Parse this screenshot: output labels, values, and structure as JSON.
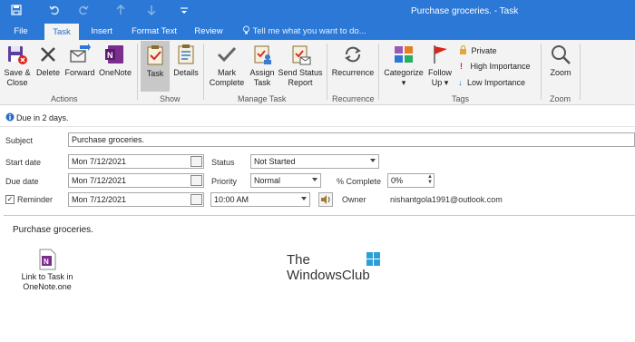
{
  "window": {
    "title": "Purchase groceries. - Task"
  },
  "quick_access": {
    "save_icon": "save-icon",
    "undo_icon": "undo-icon",
    "redo_icon": "redo-icon",
    "up_icon": "up-arrow-icon",
    "down_icon": "down-arrow-icon",
    "customize_icon": "customize-icon"
  },
  "tabs": [
    "File",
    "Task",
    "Insert",
    "Format Text",
    "Review"
  ],
  "tell_me": "Tell me what you want to do...",
  "ribbon": {
    "actions": {
      "save_close": "Save &\nClose",
      "save_close_l1": "Save &",
      "save_close_l2": "Close",
      "delete": "Delete",
      "forward": "Forward",
      "onenote": "OneNote",
      "group": "Actions"
    },
    "show": {
      "task": "Task",
      "details": "Details",
      "group": "Show"
    },
    "manage": {
      "mark_l1": "Mark",
      "mark_l2": "Complete",
      "assign_l1": "Assign",
      "assign_l2": "Task",
      "send_l1": "Send Status",
      "send_l2": "Report",
      "group": "Manage Task"
    },
    "recurrence": {
      "label": "Recurrence",
      "group": "Recurrence"
    },
    "tags": {
      "categorize": "Categorize",
      "follow_l1": "Follow",
      "follow_l2": "Up",
      "private": "Private",
      "high": "High Importance",
      "low": "Low Importance",
      "group": "Tags"
    },
    "zoom": {
      "label": "Zoom",
      "group": "Zoom"
    }
  },
  "info_bar": "Due in 2 days.",
  "form": {
    "subject_label": "Subject",
    "subject_value": "Purchase groceries.",
    "start_label": "Start date",
    "start_value": "Mon 7/12/2021",
    "due_label": "Due date",
    "due_value": "Mon 7/12/2021",
    "reminder_label": "Reminder",
    "reminder_date": "Mon 7/12/2021",
    "reminder_time": "10:00 AM",
    "status_label": "Status",
    "status_value": "Not Started",
    "priority_label": "Priority",
    "priority_value": "Normal",
    "complete_label": "% Complete",
    "complete_value": "0%",
    "owner_label": "Owner",
    "owner_value": "nishantgola1991@outlook.com"
  },
  "body": {
    "text": "Purchase groceries.",
    "attachment_l1": "Link to Task in",
    "attachment_l2": "OneNote.one"
  },
  "watermark": {
    "l1": "The",
    "l2": "WindowsClub"
  },
  "colors": {
    "accent": "#2b78d6",
    "onenote": "#7b2e8e"
  }
}
